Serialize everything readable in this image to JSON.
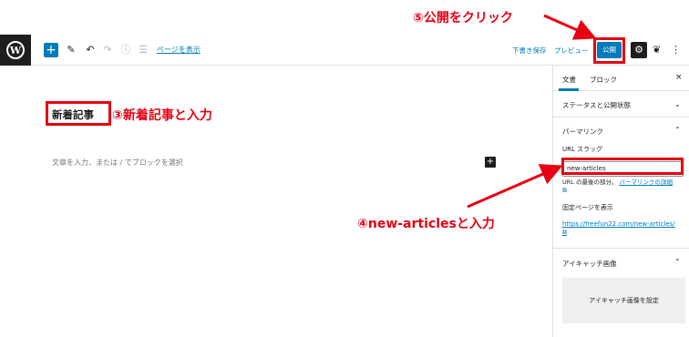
{
  "toolbar": {
    "view_page": "ページを表示",
    "save_draft": "下書き保存",
    "preview": "プレビュー",
    "publish": "公開"
  },
  "editor": {
    "title": "新着記事",
    "placeholder": "文章を入力、または / でブロックを選択"
  },
  "sidebar": {
    "tab_document": "文書",
    "tab_block": "ブロック",
    "close": "×",
    "status_panel": "ステータスと公開状態",
    "permalink_panel": "パーマリンク",
    "url_slug_label": "URL スラッグ",
    "url_slug_value": "new-articles",
    "help_prefix": "URL の最後の部分。",
    "help_link": "パーマリンクの詳細",
    "fixed_page_view": "固定ページを表示",
    "permalink_url": "https://freefun22.com/new-articles/",
    "featured_panel": "アイキャッチ画像",
    "featured_button": "アイキャッチ画像を設定"
  },
  "annotations": {
    "step5": "⑤公開をクリック",
    "step3": "③新着記事と入力",
    "step4": "④new-articlesと入力"
  },
  "colors": {
    "accent": "#007cba",
    "annotation": "#e60012",
    "dark": "#1e1e1e"
  }
}
